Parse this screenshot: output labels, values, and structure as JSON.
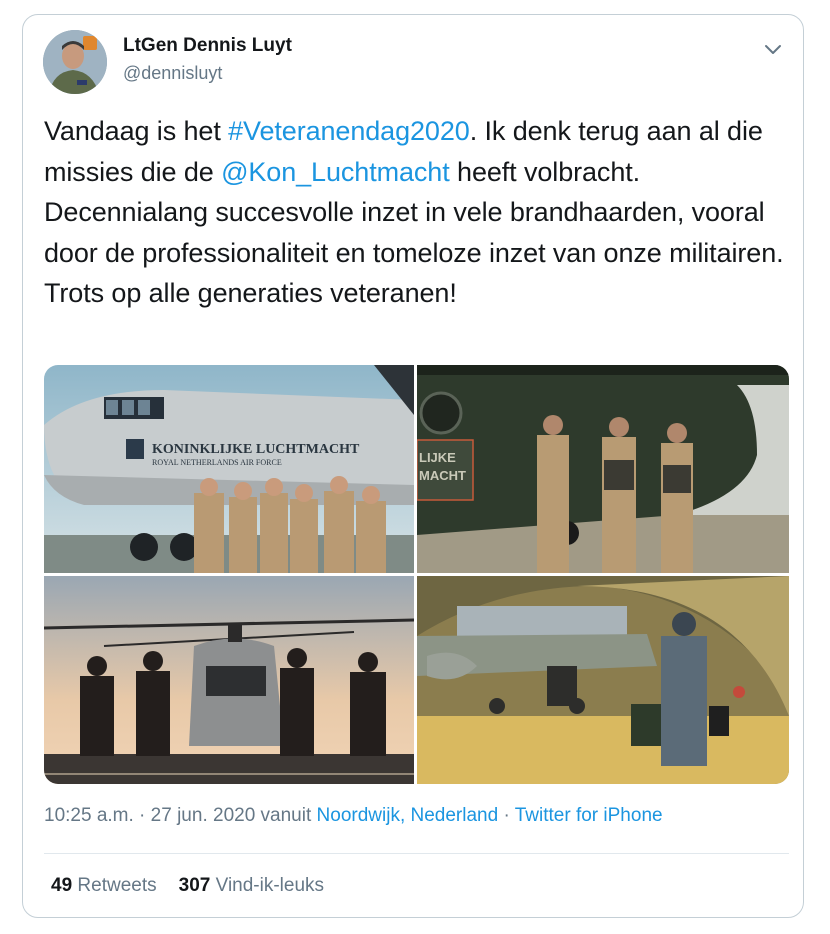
{
  "author": {
    "name": "LtGen Dennis Luyt",
    "handle": "@dennisluyt"
  },
  "tweet": {
    "text_before_hashtag": "Vandaag is het ",
    "hashtag": "#Veteranendag2020",
    "text_before_mention": ". Ik denk terug aan al die missies die de ",
    "mention": "@Kon_Luchtmacht",
    "text_after_mention": " heeft volbracht. Decennialang succesvolle inzet in vele brandhaarden, vooral door de professionaliteit en tomeloze inzet van onze militairen. Trots op alle generaties veteranen!"
  },
  "media": {
    "photo1_plane_text_line1": "KONINKLIJKE LUCHTMACHT",
    "photo1_plane_text_line2": "ROYAL NETHERLANDS AIR FORCE",
    "photo2_heli_text_line1": "LIJKE",
    "photo2_heli_text_line2": "MACHT"
  },
  "meta": {
    "time": "10:25 a.m.",
    "separator1": " · ",
    "date": "27 jun. 2020",
    "via_prefix": " vanuit ",
    "location": "Noordwijk, Nederland",
    "separator2": " · ",
    "source": "Twitter for iPhone"
  },
  "stats": {
    "retweets_count": "49",
    "retweets_label": "Retweets",
    "likes_count": "307",
    "likes_label": "Vind-ik-leuks"
  },
  "icons": {
    "menu": "chevron-down-icon"
  },
  "colors": {
    "link": "#1b95e0",
    "secondary_text": "#657786",
    "primary_text": "#14171a",
    "border": "#c4cfd6"
  }
}
